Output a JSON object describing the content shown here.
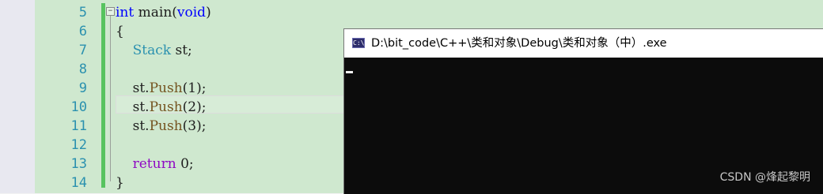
{
  "editor": {
    "line_numbers": [
      "5",
      "6",
      "7",
      "8",
      "9",
      "10",
      "11",
      "12",
      "13",
      "14"
    ],
    "fold_glyph": "⊟",
    "lines": [
      {
        "parts": [
          {
            "t": "int",
            "c": "kw"
          },
          {
            "t": " main(",
            "c": ""
          },
          {
            "t": "void",
            "c": "kw"
          },
          {
            "t": ")",
            "c": ""
          }
        ]
      },
      {
        "parts": [
          {
            "t": "{",
            "c": ""
          }
        ]
      },
      {
        "parts": [
          {
            "t": "    ",
            "c": ""
          },
          {
            "t": "Stack",
            "c": "type"
          },
          {
            "t": " st;",
            "c": ""
          }
        ]
      },
      {
        "parts": []
      },
      {
        "parts": [
          {
            "t": "    st.",
            "c": ""
          },
          {
            "t": "Push",
            "c": "fn"
          },
          {
            "t": "(1);",
            "c": ""
          }
        ]
      },
      {
        "parts": [
          {
            "t": "    st.",
            "c": ""
          },
          {
            "t": "Push",
            "c": "fn"
          },
          {
            "t": "(2);",
            "c": ""
          }
        ]
      },
      {
        "parts": [
          {
            "t": "    st.",
            "c": ""
          },
          {
            "t": "Push",
            "c": "fn"
          },
          {
            "t": "(3);",
            "c": ""
          }
        ]
      },
      {
        "parts": []
      },
      {
        "parts": [
          {
            "t": "    ",
            "c": ""
          },
          {
            "t": "return",
            "c": "purple"
          },
          {
            "t": " 0;",
            "c": ""
          }
        ]
      },
      {
        "parts": [
          {
            "t": "}",
            "c": ""
          }
        ]
      }
    ]
  },
  "console": {
    "icon_text": "C:\\",
    "title": "D:\\bit_code\\C++\\类和对象\\Debug\\类和对象（中）.exe"
  },
  "watermark": "CSDN @烽起黎明",
  "colors": {
    "editor_bg": "#cfe8cf",
    "line_number": "#2b91af",
    "keyword": "#0000ff",
    "type": "#2b91af",
    "function": "#74531f",
    "return_keyword": "#8f08c4",
    "change_bar": "#57c35f",
    "console_bg": "#0c0c0c"
  }
}
